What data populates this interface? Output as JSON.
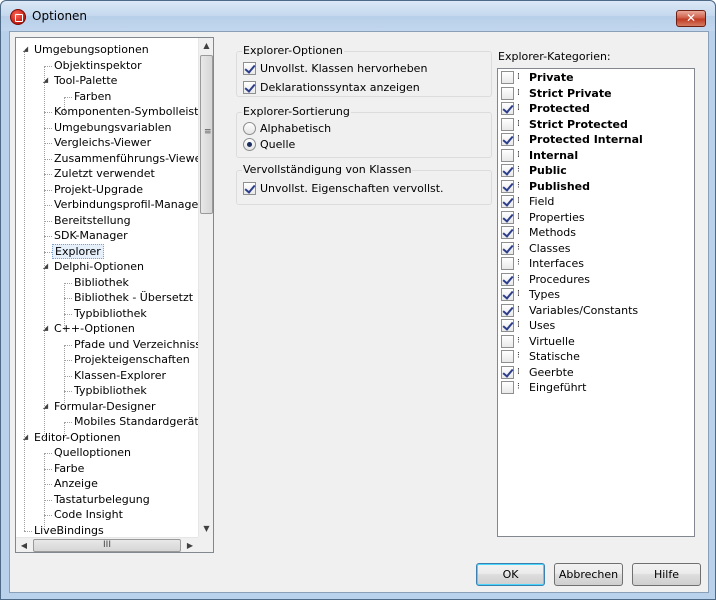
{
  "window": {
    "title": "Optionen",
    "close_glyph": "✕",
    "app_icon": "delphi-icon"
  },
  "tree": {
    "items": [
      {
        "label": "Umgebungsoptionen",
        "level": 0,
        "expander": "expanded",
        "selected": false
      },
      {
        "label": "Objektinspektor",
        "level": 1,
        "expander": "",
        "selected": false
      },
      {
        "label": "Tool-Palette",
        "level": 1,
        "expander": "expanded",
        "selected": false
      },
      {
        "label": "Farben",
        "level": 2,
        "expander": "",
        "selected": false
      },
      {
        "label": "Komponenten-Symbolleiste",
        "level": 1,
        "expander": "",
        "selected": false
      },
      {
        "label": "Umgebungsvariablen",
        "level": 1,
        "expander": "",
        "selected": false
      },
      {
        "label": "Vergleichs-Viewer",
        "level": 1,
        "expander": "",
        "selected": false
      },
      {
        "label": "Zusammenführungs-Viewer",
        "level": 1,
        "expander": "",
        "selected": false
      },
      {
        "label": "Zuletzt verwendet",
        "level": 1,
        "expander": "",
        "selected": false
      },
      {
        "label": "Projekt-Upgrade",
        "level": 1,
        "expander": "",
        "selected": false
      },
      {
        "label": "Verbindungsprofil-Manager",
        "level": 1,
        "expander": "",
        "selected": false
      },
      {
        "label": "Bereitstellung",
        "level": 1,
        "expander": "",
        "selected": false
      },
      {
        "label": "SDK-Manager",
        "level": 1,
        "expander": "",
        "selected": false
      },
      {
        "label": "Explorer",
        "level": 1,
        "expander": "",
        "selected": true
      },
      {
        "label": "Delphi-Optionen",
        "level": 1,
        "expander": "expanded",
        "selected": false
      },
      {
        "label": "Bibliothek",
        "level": 2,
        "expander": "",
        "selected": false
      },
      {
        "label": "Bibliothek - Übersetzt",
        "level": 2,
        "expander": "",
        "selected": false
      },
      {
        "label": "Typbibliothek",
        "level": 2,
        "expander": "",
        "selected": false
      },
      {
        "label": "C++-Optionen",
        "level": 1,
        "expander": "expanded",
        "selected": false
      },
      {
        "label": "Pfade und Verzeichnisse",
        "level": 2,
        "expander": "",
        "selected": false
      },
      {
        "label": "Projekteigenschaften",
        "level": 2,
        "expander": "",
        "selected": false
      },
      {
        "label": "Klassen-Explorer",
        "level": 2,
        "expander": "",
        "selected": false
      },
      {
        "label": "Typbibliothek",
        "level": 2,
        "expander": "",
        "selected": false
      },
      {
        "label": "Formular-Designer",
        "level": 1,
        "expander": "expanded",
        "selected": false
      },
      {
        "label": "Mobiles Standardgerät",
        "level": 2,
        "expander": "",
        "selected": false
      },
      {
        "label": "Editor-Optionen",
        "level": 0,
        "expander": "expanded",
        "selected": false
      },
      {
        "label": "Quelloptionen",
        "level": 1,
        "expander": "",
        "selected": false
      },
      {
        "label": "Farbe",
        "level": 1,
        "expander": "",
        "selected": false
      },
      {
        "label": "Anzeige",
        "level": 1,
        "expander": "",
        "selected": false
      },
      {
        "label": "Tastaturbelegung",
        "level": 1,
        "expander": "",
        "selected": false
      },
      {
        "label": "Code Insight",
        "level": 1,
        "expander": "",
        "selected": false
      },
      {
        "label": "LiveBindings",
        "level": 0,
        "expander": "",
        "selected": false
      }
    ],
    "hscroll_grip": "III",
    "vscroll_grip": "≡"
  },
  "explorer_options": {
    "title": "Explorer-Optionen",
    "highlight_incomplete": {
      "label": "Unvollst. Klassen hervorheben",
      "checked": true
    },
    "show_declaration_syntax": {
      "label": "Deklarationssyntax anzeigen",
      "checked": true
    }
  },
  "explorer_sorting": {
    "title": "Explorer-Sortierung",
    "options": [
      {
        "label": "Alphabetisch",
        "checked": false
      },
      {
        "label": "Quelle",
        "checked": true
      }
    ]
  },
  "class_completion": {
    "title": "Vervollständigung von Klassen",
    "complete_properties": {
      "label": "Unvollst. Eigenschaften vervollst.",
      "checked": true
    }
  },
  "categories": {
    "label": "Explorer-Kategorien:",
    "items": [
      {
        "label": "Private",
        "checked": false,
        "bold": true,
        "icon": "⁞"
      },
      {
        "label": "Strict Private",
        "checked": false,
        "bold": true,
        "icon": "⁞"
      },
      {
        "label": "Protected",
        "checked": true,
        "bold": true,
        "icon": "⁞"
      },
      {
        "label": "Strict Protected",
        "checked": false,
        "bold": true,
        "icon": "⁞"
      },
      {
        "label": "Protected Internal",
        "checked": true,
        "bold": true,
        "icon": "⁞"
      },
      {
        "label": "Internal",
        "checked": false,
        "bold": true,
        "icon": "⁞"
      },
      {
        "label": "Public",
        "checked": true,
        "bold": true,
        "icon": "⁝"
      },
      {
        "label": "Published",
        "checked": true,
        "bold": true,
        "icon": "⁝"
      },
      {
        "label": "Field",
        "checked": true,
        "bold": false,
        "icon": "⁞"
      },
      {
        "label": "Properties",
        "checked": true,
        "bold": false,
        "icon": "⁞"
      },
      {
        "label": "Methods",
        "checked": true,
        "bold": false,
        "icon": "⁞"
      },
      {
        "label": "Classes",
        "checked": true,
        "bold": false,
        "icon": "⁝"
      },
      {
        "label": "Interfaces",
        "checked": false,
        "bold": false,
        "icon": "⁝"
      },
      {
        "label": "Procedures",
        "checked": true,
        "bold": false,
        "icon": "⁝"
      },
      {
        "label": "Types",
        "checked": true,
        "bold": false,
        "icon": "⁞"
      },
      {
        "label": "Variables/Constants",
        "checked": true,
        "bold": false,
        "icon": "⁞"
      },
      {
        "label": "Uses",
        "checked": true,
        "bold": false,
        "icon": "⁞"
      },
      {
        "label": "Virtuelle",
        "checked": false,
        "bold": false,
        "icon": "⁝"
      },
      {
        "label": "Statische",
        "checked": false,
        "bold": false,
        "icon": "⁝"
      },
      {
        "label": "Geerbte",
        "checked": true,
        "bold": false,
        "icon": "⁞"
      },
      {
        "label": "Eingeführt",
        "checked": false,
        "bold": false,
        "icon": "⁝"
      }
    ]
  },
  "buttons": {
    "ok": "OK",
    "cancel": "Abbrechen",
    "help": "Hilfe"
  }
}
